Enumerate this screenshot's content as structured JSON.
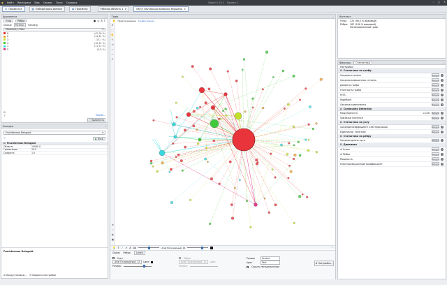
{
  "window": {
    "title": "Gephi 0.10.1 - Проект 1",
    "menu": [
      "Файл",
      "Workspace",
      "Вид",
      "Сервис",
      "Окно",
      "Справка"
    ]
  },
  "workspace_tabs": [
    {
      "label": "Обработка",
      "active": true
    },
    {
      "label": "Лаборатория данных",
      "active": false
    },
    {
      "label": "Просмотр",
      "active": false
    }
  ],
  "doc_tabs": [
    "Рабочая область 1",
    "ВКТЛ_обучающая выборка_вершины"
  ],
  "left_panel": {
    "title": "Appearance",
    "mode_tabs": [
      "Узлы",
      "Рёбра"
    ],
    "sub_tabs": [
      "Unique",
      "Partition",
      "Ranking"
    ],
    "active_sub_tab": "Partition",
    "attribute": "Modularity Class",
    "partitions": [
      {
        "name": "0",
        "pct": "(42,76 %)",
        "color": "#e8343a"
      },
      {
        "name": "2",
        "pct": "(14,45 %)",
        "color": "#e8a33a"
      },
      {
        "name": "3",
        "pct": "(13,7 %)",
        "color": "#c2df2a"
      },
      {
        "name": "4",
        "pct": "(12,41 %)",
        "color": "#41c93c"
      },
      {
        "name": "1",
        "pct": "(11,72 %)",
        "color": "#38d8e0"
      },
      {
        "name": "5",
        "pct": "(4,8 %)",
        "color": "#e03a8b"
      }
    ],
    "palette_link": "Palette...",
    "apply_label": "Применить"
  },
  "layout_panel": {
    "title": "Укладка",
    "algorithm": "Fruchterman Reingold",
    "run_label": "Пуск",
    "section": "Fruchterman Reingold",
    "properties": [
      {
        "key": "Область",
        "value": "10000.0"
      },
      {
        "key": "Гравитация",
        "value": "10.0"
      },
      {
        "key": "Скорость",
        "value": "1.0"
      }
    ],
    "desc_title": "Fruchterman Reingold",
    "presets_label": "Предустановки...",
    "reset_label": "Сбросить настройки"
  },
  "graph_panel": {
    "title": "Граф",
    "mode": "Перетаскивание",
    "config": "Конфигурация"
  },
  "bottom_toolbar": {
    "font_label": "Arial Полужирный, 12",
    "tabs": [
      "Global",
      "Рёбра",
      "Labels"
    ],
    "active_tab": "Labels",
    "nodes_label": "Узел",
    "edges_label": "Рёбра",
    "size_label": "Размер:",
    "color_label": "Цвет:",
    "text_size_label": "Размер",
    "text_color_label": "Цвет",
    "size_value": "Scaled",
    "color_value": "Text",
    "hide_label": "Скрыть ненадписанные",
    "settings_label": "Настройки..."
  },
  "context_panel": {
    "title": "Контекст",
    "lines": [
      {
        "key": "Узлы:",
        "value": "125 (98,5 % видимый)"
      },
      {
        "key": "Рёбра:",
        "value": "187 (100 % видимый)"
      },
      {
        "key": "",
        "value": "Ненаправленный граф"
      }
    ]
  },
  "stats_panel": {
    "tabs": [
      "Фильтры",
      "Статистика"
    ],
    "active_tab": "Статистика",
    "settings_label": "Настройки",
    "run_label": "Запуск",
    "sections": [
      {
        "title": "Статистика по графу",
        "rows": [
          {
            "name": "Средняя степень",
            "value": ""
          },
          {
            "name": "Средняя взвешенная степень",
            "value": ""
          },
          {
            "name": "Диаметр графа",
            "value": ""
          },
          {
            "name": "Плотность графа",
            "value": ""
          },
          {
            "name": "HITS",
            "value": ""
          },
          {
            "name": "PageRank",
            "value": ""
          },
          {
            "name": "Связные компоненты",
            "value": ""
          }
        ]
      },
      {
        "title": "Community Detection",
        "rows": [
          {
            "name": "Модулярность",
            "value": "0,226"
          },
          {
            "name": "Statistical Inference",
            "value": ""
          }
        ]
      },
      {
        "title": "Статистика по узлу",
        "rows": [
          {
            "name": "Средний коэффициент кластеризации",
            "value": ""
          },
          {
            "name": "Eigenvector Centrality",
            "value": ""
          }
        ]
      },
      {
        "title": "Статистика по ребру",
        "rows": [
          {
            "name": "Средняя длина пути",
            "value": ""
          }
        ]
      },
      {
        "title": "Динамика",
        "rows": [
          {
            "name": "# Узлов",
            "value": ""
          },
          {
            "name": "# Рёбер",
            "value": ""
          },
          {
            "name": "Мощность",
            "value": ""
          },
          {
            "name": "Кластеризационный коэффициент",
            "value": ""
          }
        ]
      }
    ]
  }
}
